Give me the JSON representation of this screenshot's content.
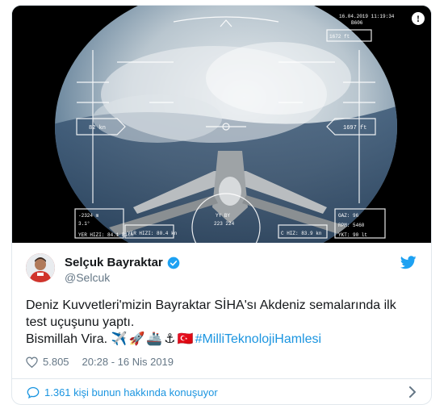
{
  "media": {
    "hud_date": "16.04.2019 11:19:34",
    "hud_code": "B606",
    "hud_altitude": "1697 ft",
    "hud_speed": "82 kn",
    "hud_top_right": "1672 ft",
    "hud_left_vs": "-2324 m",
    "hud_left_row2": "3.1°",
    "hud_hizi": "YER HIZI: 84.1 Rich",
    "hud_yer": "YER HIZI: 80.4 kn",
    "hud_heading_row1": "YY  BY",
    "hud_heading_row2": "223  224",
    "hud_gaz": "GAZ: 96",
    "hud_rpm": "RPM: 5460",
    "hud_ykt": "YKT: 90 lt",
    "hud_chizi": "C HIZ: 83.9 kn",
    "info_icon": "info-icon"
  },
  "tweet": {
    "name": "Selçuk Bayraktar",
    "handle": "@Selcuk",
    "line1": "Deniz Kuvvetleri'mizin Bayraktar SİHA'sı Akdeniz semalarında ilk",
    "line2": "test uçuşunu yaptı.",
    "line3_text": "Bismillah Vira.",
    "emojis": [
      "✈️",
      "🚀",
      "🚢",
      "⚓",
      "🇹🇷"
    ],
    "hashtag": "#MilliTeknolojiHamlesi",
    "likes": "5.805",
    "timestamp": "20:28 - 16 Nis 2019",
    "conversation": "1.361 kişi bunun hakkında konuşuyor"
  },
  "colors": {
    "link": "#1b95e0",
    "verified": "#1da1f2",
    "muted": "#657786"
  }
}
